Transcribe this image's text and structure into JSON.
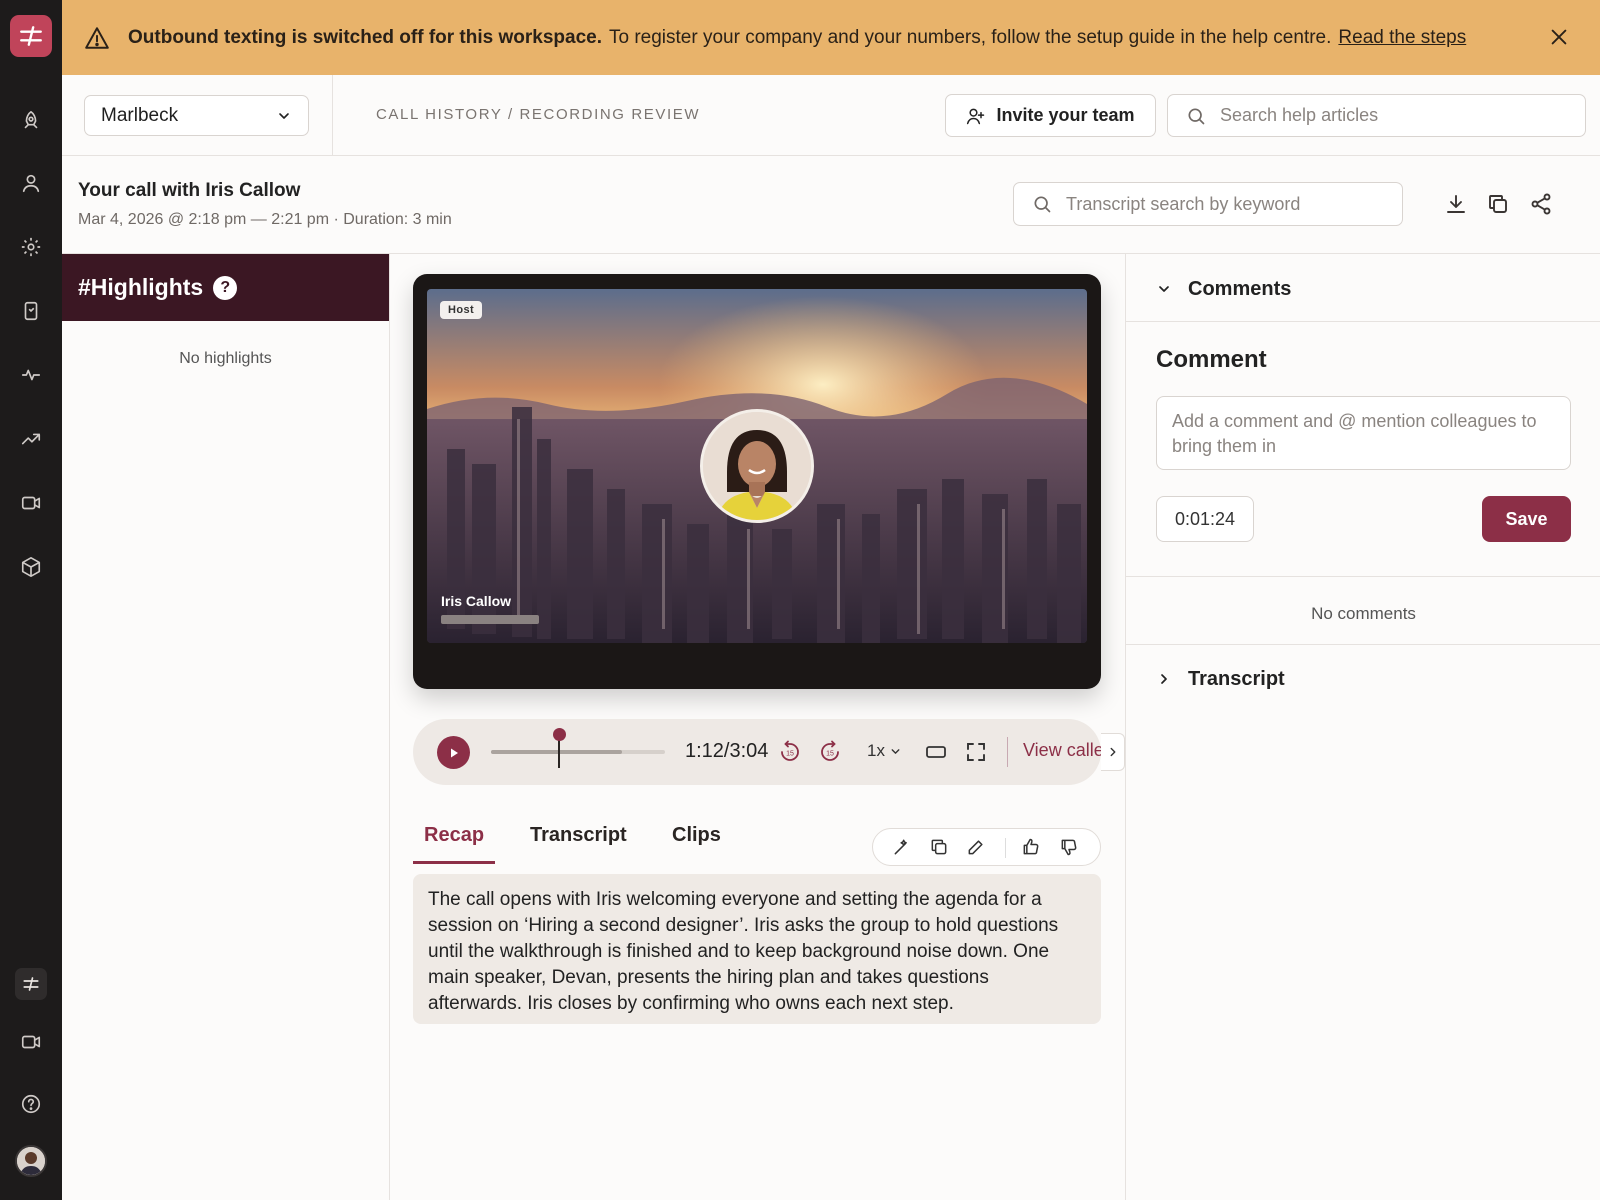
{
  "banner": {
    "bold": "Outbound texting is switched off for this workspace.",
    "text": "To register your company and your numbers, follow the setup guide in the help centre.",
    "link": "Read the steps",
    "color": "#e8b36b"
  },
  "topbar": {
    "workspace": "Marlbeck",
    "breadcrumb": "CALL HISTORY / RECORDING REVIEW",
    "invite_label": "Invite your team",
    "help_search_placeholder": "Search help articles"
  },
  "call": {
    "title": "Your call with Iris Callow",
    "meta": "Mar 4, 2026 @ 2:18 pm — 2:21 pm · Duration: 3 min",
    "transcript_search_placeholder": "Transcript search by keyword"
  },
  "highlights": {
    "title": "#Highlights",
    "help": "?",
    "empty": "No highlights"
  },
  "video": {
    "host_badge": "Host",
    "speaker_name": "Iris Callow"
  },
  "player": {
    "time": "1:12/3:04",
    "progress_fraction": 0.391,
    "buffered_fraction": 0.75,
    "rewind_seconds": "15",
    "forward_seconds": "15",
    "speed": "1x",
    "view_caller_label": "View caller"
  },
  "tabs": [
    {
      "label": "Recap",
      "active": true
    },
    {
      "label": "Transcript",
      "active": false
    },
    {
      "label": "Clips",
      "active": false
    }
  ],
  "recap": {
    "text": "The call opens with Iris welcoming everyone and setting the agenda for a session on ‘Hiring a second designer’. Iris asks the group to hold questions until the walkthrough is finished and to keep background noise down. One main speaker, Devan, presents the hiring plan and takes questions afterwards. Iris closes by confirming who owns each next step."
  },
  "comments": {
    "section_label": "Comments",
    "title": "Comment",
    "placeholder": "Add a comment and @ mention colleagues to bring them in",
    "timestamp": "0:01:24",
    "save_label": "Save",
    "empty": "No comments"
  },
  "transcript_section": {
    "label": "Transcript"
  },
  "colors": {
    "accent": "#8c2f47",
    "rail": "#1d1b1b",
    "highlights_header": "#3b1723",
    "logo": "#c0445a"
  }
}
